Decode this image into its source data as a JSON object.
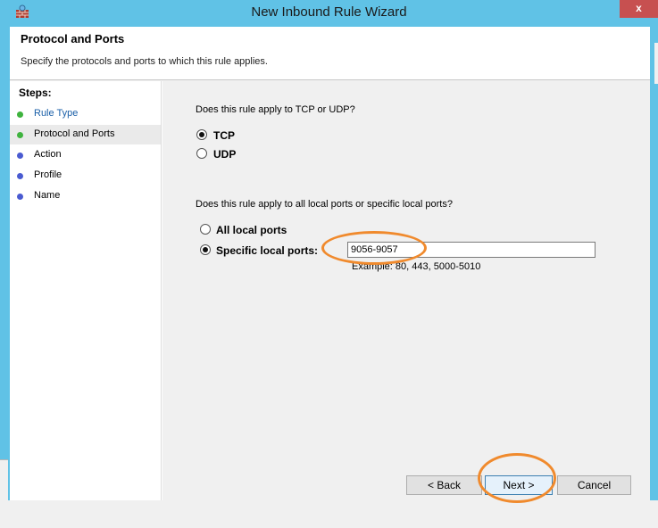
{
  "window": {
    "title": "New Inbound Rule Wizard",
    "close_glyph": "x",
    "icon": "firewall-icon"
  },
  "header": {
    "title": "Protocol and Ports",
    "subtitle": "Specify the protocols and ports to which this rule applies."
  },
  "steps": {
    "label": "Steps:",
    "items": [
      {
        "label": "Rule Type",
        "status_color": "#3fb33f"
      },
      {
        "label": "Protocol and Ports",
        "status_color": "#3fb33f"
      },
      {
        "label": "Action",
        "status_color": "#4a5bd1"
      },
      {
        "label": "Profile",
        "status_color": "#4a5bd1"
      },
      {
        "label": "Name",
        "status_color": "#4a5bd1"
      }
    ]
  },
  "protocol": {
    "question": "Does this rule apply to TCP or UDP?",
    "options": [
      {
        "label": "TCP",
        "checked": true
      },
      {
        "label": "UDP",
        "checked": false
      }
    ]
  },
  "ports": {
    "question": "Does this rule apply to all local ports or specific local ports?",
    "options": [
      {
        "label": "All local ports",
        "checked": false
      },
      {
        "label": "Specific local ports:",
        "checked": true
      }
    ],
    "input_value": "9056-9057",
    "example": "Example: 80, 443, 5000-5010"
  },
  "buttons": {
    "back": "< Back",
    "next": "Next >",
    "cancel": "Cancel"
  },
  "colors": {
    "titlebar": "#60c2e6",
    "close": "#c75050",
    "highlight": "#f08a2d"
  }
}
